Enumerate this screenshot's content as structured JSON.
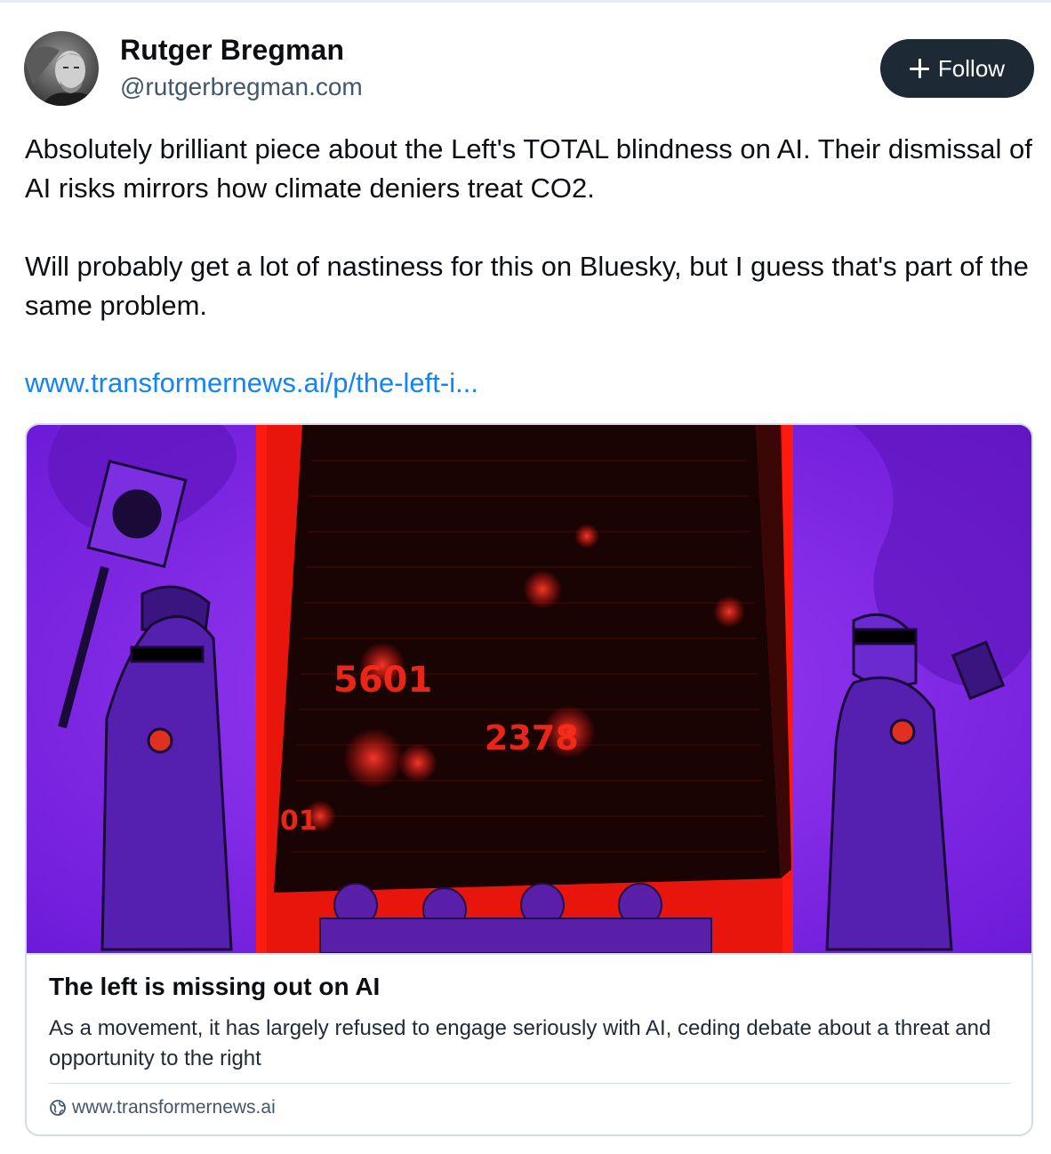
{
  "author": {
    "display_name": "Rutger Bregman",
    "handle": "@rutgerbregman.com",
    "avatar_icon": "avatar-photo"
  },
  "follow_button": {
    "icon": "plus-icon",
    "label": "Follow"
  },
  "post": {
    "paragraph_1": "Absolutely brilliant piece about the Left's TOTAL blindness on AI. Their dismissal of AI risks mirrors how climate deniers treat CO2.",
    "paragraph_2": "Will probably get a lot of nastiness for this on Bluesky, but I guess that's part of the same problem.",
    "link_text": "www.transformernews.ai/p/the-left-i..."
  },
  "link_card": {
    "title": "The left is missing out on AI",
    "description": "As a movement, it has largely refused to engage seriously with AI, ceding debate about a threat and opportunity to the right",
    "domain": "www.transformernews.ai",
    "domain_icon": "globe-icon",
    "image": {
      "numbers_on_screen": [
        "5601",
        "2378",
        "01"
      ]
    }
  },
  "colors": {
    "accent_link": "#1083fe",
    "follow_bg": "#1e2936",
    "handle_gray": "#42576c",
    "image_purple": "#7a1fe0",
    "image_red": "#ff1a10"
  }
}
